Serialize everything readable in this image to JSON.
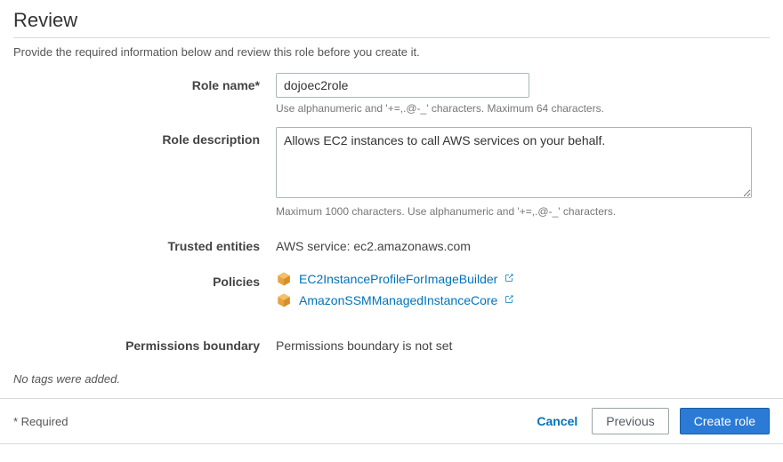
{
  "heading": "Review",
  "subtitle": "Provide the required information below and review this role before you create it.",
  "form": {
    "roleName": {
      "label": "Role name*",
      "value": "dojoec2role",
      "helper": "Use alphanumeric and '+=,.@-_' characters. Maximum 64 characters."
    },
    "roleDescription": {
      "label": "Role description",
      "value": "Allows EC2 instances to call AWS services on your behalf.",
      "helper": "Maximum 1000 characters. Use alphanumeric and '+=,.@-_' characters."
    },
    "trustedEntities": {
      "label": "Trusted entities",
      "value": "AWS service: ec2.amazonaws.com"
    },
    "policies": {
      "label": "Policies",
      "items": [
        "EC2InstanceProfileForImageBuilder",
        "AmazonSSMManagedInstanceCore"
      ]
    },
    "permissionsBoundary": {
      "label": "Permissions boundary",
      "value": "Permissions boundary is not set"
    }
  },
  "tagsNote": "No tags were added.",
  "footer": {
    "requiredNote": "* Required",
    "cancel": "Cancel",
    "previous": "Previous",
    "create": "Create role"
  }
}
